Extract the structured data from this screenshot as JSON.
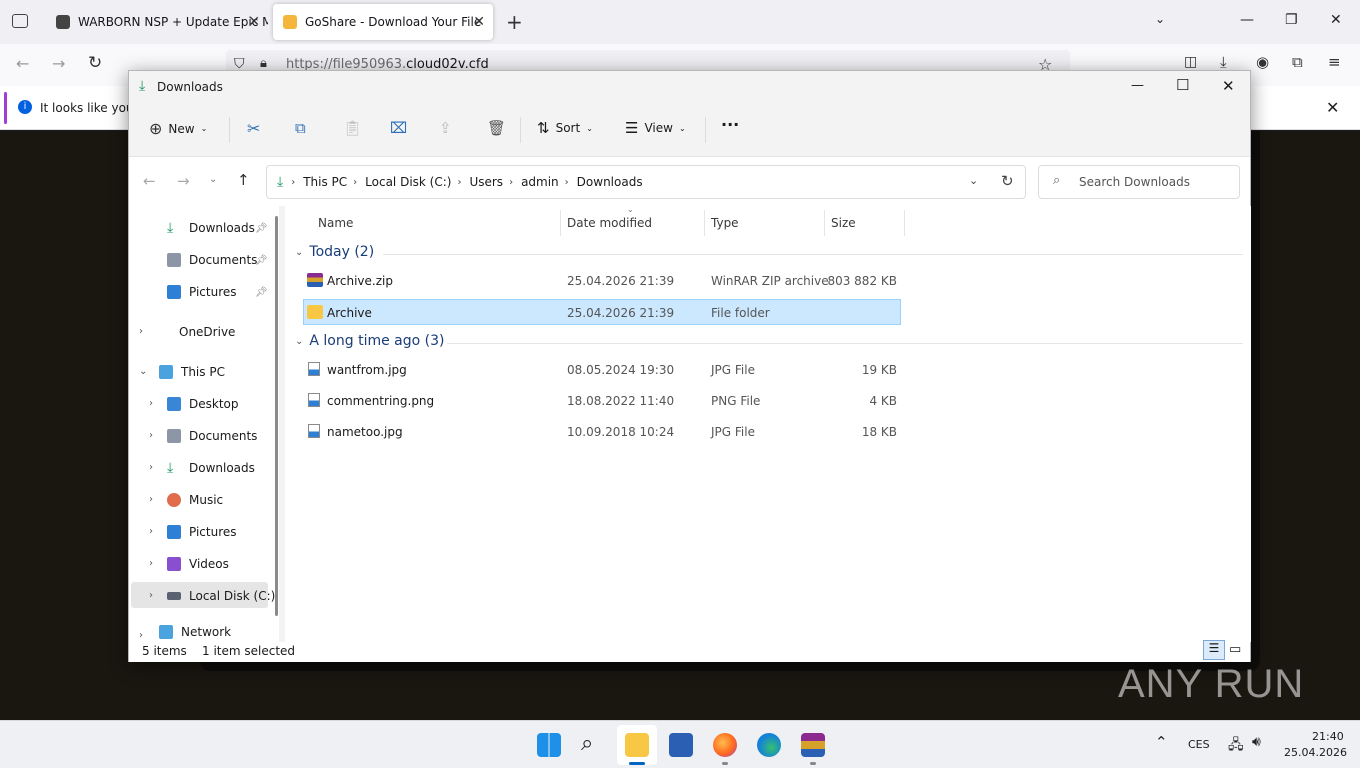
{
  "browser": {
    "tabs": [
      {
        "label": "WARBORN NSP + Update Epic M",
        "active": false
      },
      {
        "label": "GoShare - Download Your File",
        "active": true
      }
    ],
    "url_prefix": "https://file950963.",
    "url_domain": "cloud02v.cfd",
    "notification_text": "It looks like you h"
  },
  "explorer": {
    "title": "Downloads",
    "toolbar": {
      "new_label": "New",
      "sort_label": "Sort",
      "view_label": "View",
      "more_label": "···"
    },
    "breadcrumb": [
      "This PC",
      "Local Disk (C:)",
      "Users",
      "admin",
      "Downloads"
    ],
    "search_placeholder": "Search Downloads",
    "sidebar": {
      "quick_access": [
        {
          "label": "Downloads",
          "icon": "download-icon"
        },
        {
          "label": "Documents",
          "icon": "document-icon"
        },
        {
          "label": "Pictures",
          "icon": "picture-icon"
        }
      ],
      "onedrive": "OneDrive",
      "this_pc": "This PC",
      "pc_items": [
        {
          "label": "Desktop",
          "icon": "desktop-icon"
        },
        {
          "label": "Documents",
          "icon": "document-icon"
        },
        {
          "label": "Downloads",
          "icon": "download-icon"
        },
        {
          "label": "Music",
          "icon": "music-icon"
        },
        {
          "label": "Pictures",
          "icon": "picture-icon"
        },
        {
          "label": "Videos",
          "icon": "video-icon"
        },
        {
          "label": "Local Disk (C:)",
          "icon": "drive-icon"
        }
      ],
      "network": "Network"
    },
    "columns": {
      "name": "Name",
      "date": "Date modified",
      "type": "Type",
      "size": "Size"
    },
    "groups": [
      {
        "label": "Today (2)",
        "files": [
          {
            "name": "Archive.zip",
            "date": "25.04.2026 21:39",
            "type": "WinRAR ZIP archive",
            "size": "803 882 KB",
            "icon": "winrar-icon",
            "selected": false
          },
          {
            "name": "Archive",
            "date": "25.04.2026 21:39",
            "type": "File folder",
            "size": "",
            "icon": "folder-icon",
            "selected": true
          }
        ]
      },
      {
        "label": "A long time ago (3)",
        "files": [
          {
            "name": "wantfrom.jpg",
            "date": "08.05.2024 19:30",
            "type": "JPG File",
            "size": "19 KB",
            "icon": "image-file-icon",
            "selected": false
          },
          {
            "name": "commentring.png",
            "date": "18.08.2022 11:40",
            "type": "PNG File",
            "size": "4 KB",
            "icon": "image-file-icon",
            "selected": false
          },
          {
            "name": "nametoo.jpg",
            "date": "10.09.2018 10:24",
            "type": "JPG File",
            "size": "18 KB",
            "icon": "image-file-icon",
            "selected": false
          }
        ]
      }
    ],
    "status": {
      "items": "5 items",
      "selected": "1 item selected"
    }
  },
  "taskbar": {
    "language": "CES",
    "time": "21:40",
    "date": "25.04.2026"
  },
  "watermark": "ANY RUN",
  "colors": {
    "accent": "#0078d4",
    "selection": "#cce8ff",
    "folder": "#f8c845"
  }
}
